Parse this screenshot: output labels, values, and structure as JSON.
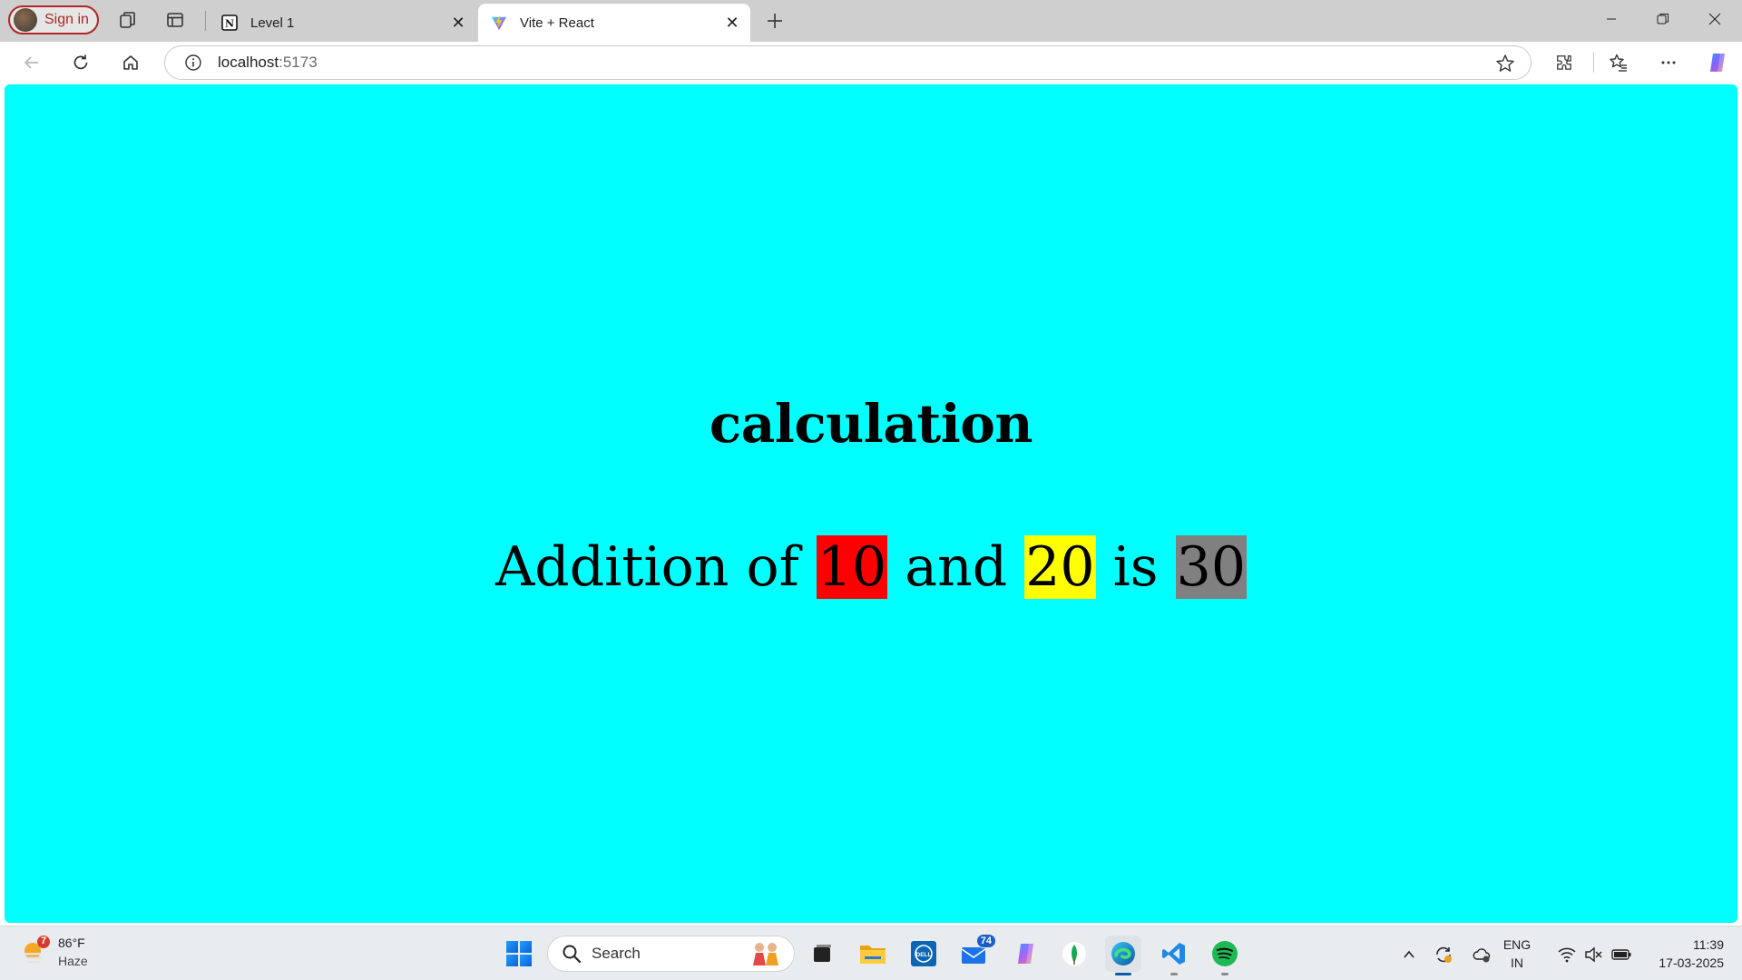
{
  "browser": {
    "profile_label": "Sign in",
    "tabs": [
      {
        "title": "Level 1",
        "icon": "notion-icon",
        "active": false
      },
      {
        "title": "Vite + React",
        "icon": "vite-icon",
        "active": true
      }
    ],
    "address": {
      "host": "localhost",
      "port": ":5173"
    }
  },
  "page": {
    "background": "#00ffff",
    "heading": "calculation",
    "sentence": {
      "prefix": "Addition of ",
      "a": "10",
      "middle": " and ",
      "b": "20",
      "is_word": " is ",
      "result": "30",
      "a_bg": "#ff0000",
      "b_bg": "#ffff00",
      "result_bg": "#808080"
    }
  },
  "taskbar": {
    "weather": {
      "temp": "86°F",
      "condition": "Haze",
      "badge": "7"
    },
    "search_label": "Search",
    "mail_badge": "74",
    "language": {
      "line1": "ENG",
      "line2": "IN"
    },
    "clock": {
      "time": "11:39",
      "date": "17-03-2025"
    }
  }
}
